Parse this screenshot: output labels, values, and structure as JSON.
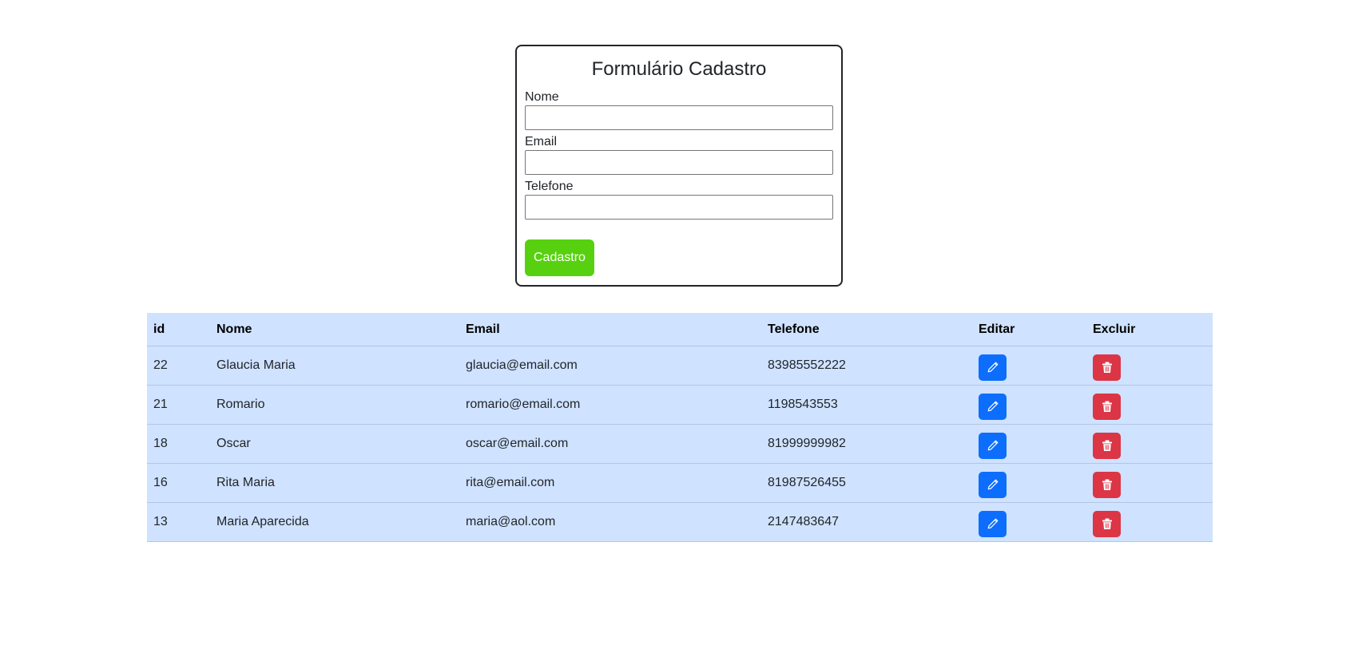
{
  "form": {
    "title": "Formulário Cadastro",
    "fields": [
      {
        "label": "Nome",
        "value": "",
        "placeholder": ""
      },
      {
        "label": "Email",
        "value": "",
        "placeholder": ""
      },
      {
        "label": "Telefone",
        "value": "",
        "placeholder": ""
      }
    ],
    "submit_label": "Cadastro"
  },
  "table": {
    "headers": [
      "id",
      "Nome",
      "Email",
      "Telefone",
      "Editar",
      "Excluir"
    ],
    "rows": [
      {
        "id": "22",
        "nome": "Glaucia Maria",
        "email": "glaucia@email.com",
        "telefone": "83985552222"
      },
      {
        "id": "21",
        "nome": "Romario",
        "email": "romario@email.com",
        "telefone": "1198543553"
      },
      {
        "id": "18",
        "nome": "Oscar",
        "email": "oscar@email.com",
        "telefone": "81999999982"
      },
      {
        "id": "16",
        "nome": "Rita Maria",
        "email": "rita@email.com",
        "telefone": "81987526455"
      },
      {
        "id": "13",
        "nome": "Maria Aparecida",
        "email": "maria@aol.com",
        "telefone": "2147483647"
      }
    ],
    "edit_icon": "pencil-icon",
    "delete_icon": "trash-icon"
  },
  "colors": {
    "submit_button": "#57d10f",
    "edit_button": "#0d6efd",
    "delete_button": "#dc3545",
    "table_background": "#cfe2ff"
  }
}
